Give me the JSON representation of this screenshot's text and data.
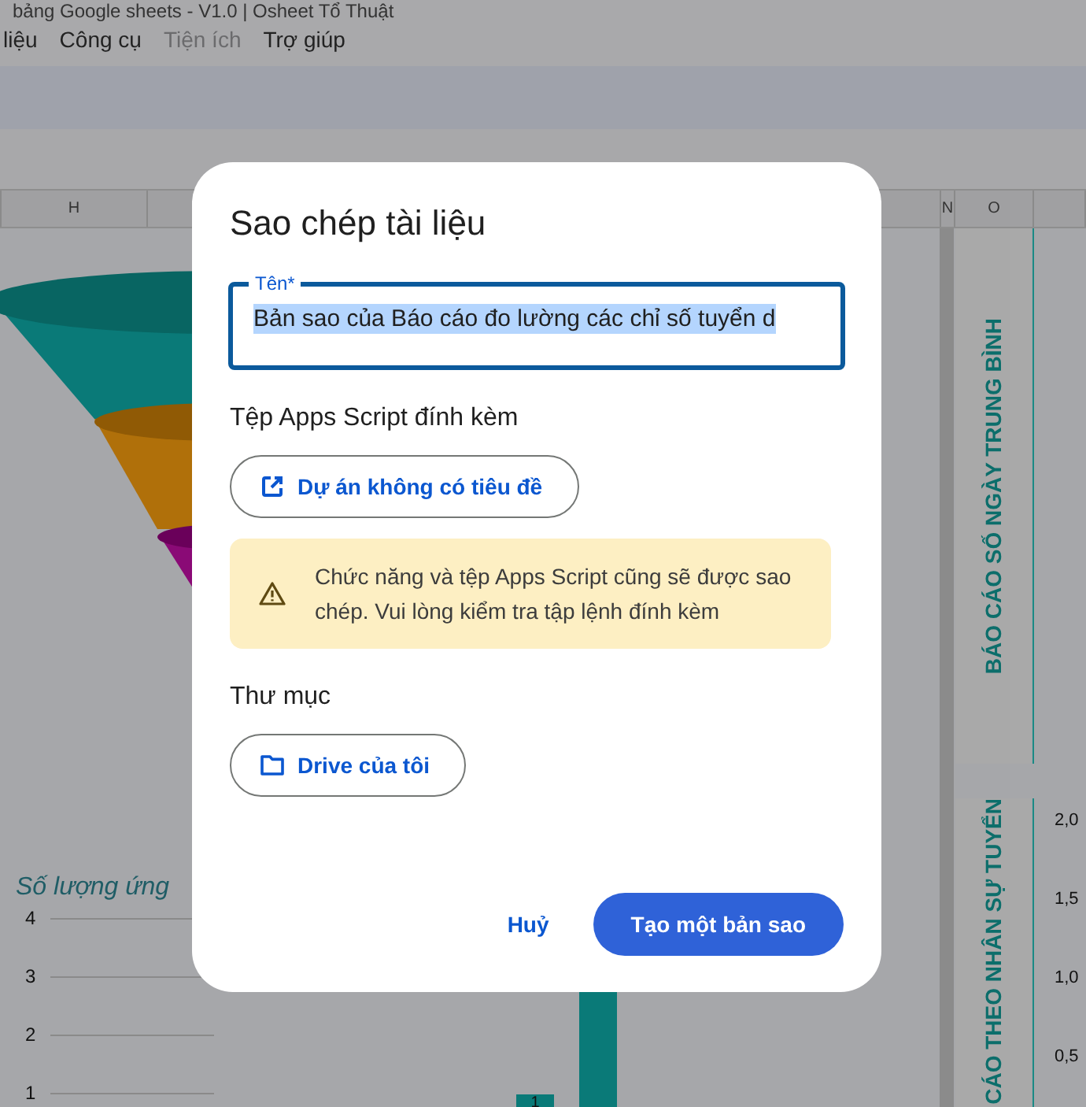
{
  "document_title": "bảng Google sheets - V1.0 | Osheet Tổ Thuật",
  "menu": [
    {
      "label": "liệu",
      "disabled": false
    },
    {
      "label": "Công cụ",
      "disabled": false
    },
    {
      "label": "Tiện ích",
      "disabled": true
    },
    {
      "label": "Trợ giúp",
      "disabled": false
    }
  ],
  "column_headers": [
    "H",
    "N",
    "O"
  ],
  "sheet": {
    "chart_title": "Số lượng ứng",
    "y_ticks": [
      "4",
      "3",
      "2",
      "1"
    ],
    "bar_label": "1",
    "vertical_titles": [
      "BÁO CÁO SỐ NGÀY TRUNG BÌNH",
      "CÁO THEO NHÂN SỰ TUYỂN"
    ],
    "right_values": [
      "2,0",
      "1,5",
      "1,0",
      "0,5"
    ]
  },
  "dialog": {
    "title": "Sao chép tài liệu",
    "name_field": {
      "label": "Tên*",
      "value": "Bản sao của Báo cáo đo lường các chỉ số tuyển d",
      "text_selected": true
    },
    "script_heading": "Tệp Apps Script đính kèm",
    "script_button": "Dự án không có tiêu đề",
    "warning": "Chức năng và tệp Apps Script cũng sẽ được sao chép. Vui lòng kiểm tra tập lệnh đính kèm",
    "folder_heading": "Thư mục",
    "folder_button": "Drive của tôi",
    "cancel_button": "Huỷ",
    "confirm_button": "Tạo một bản sao"
  }
}
